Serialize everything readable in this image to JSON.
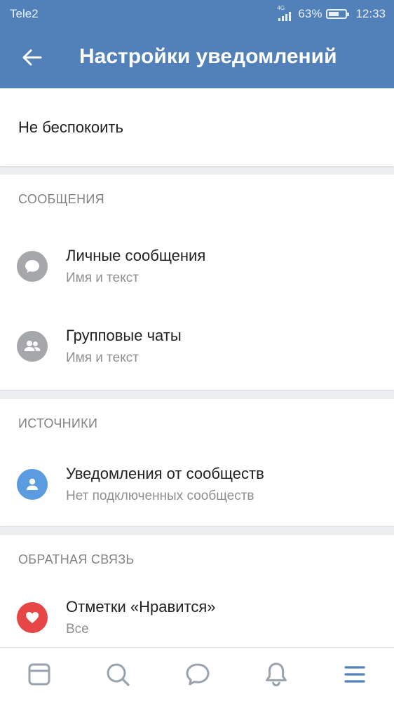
{
  "status_bar": {
    "carrier": "Tele2",
    "network_label": "4G",
    "battery": "63%",
    "battery_level": 0.63,
    "time": "12:33"
  },
  "header": {
    "title": "Настройки уведомлений",
    "back_icon": "arrow-left-icon"
  },
  "do_not_disturb": {
    "label": "Не беспокоить"
  },
  "sections": [
    {
      "title": "СООБЩЕНИЯ",
      "items": [
        {
          "icon": "chat-bubble-icon",
          "title": "Личные сообщения",
          "subtitle": "Имя и текст"
        },
        {
          "icon": "group-icon",
          "title": "Групповые чаты",
          "subtitle": "Имя и текст"
        }
      ]
    },
    {
      "title": "ИСТОЧНИКИ",
      "items": [
        {
          "icon": "user-icon",
          "title": "Уведомления от сообществ",
          "subtitle": "Нет подключенных сообществ"
        }
      ]
    },
    {
      "title": "ОБРАТНАЯ СВЯЗЬ",
      "items": [
        {
          "icon": "heart-icon",
          "title": "Отметки «Нравится»",
          "subtitle": "Все"
        }
      ]
    }
  ],
  "colors": {
    "header": "#5181b8",
    "background": "#ebedf0",
    "gray_icon": "#a5a7ab",
    "blue_icon": "#5b9be0",
    "red_icon": "#e64646",
    "accent": "#5181b8"
  },
  "tabbar": {
    "tabs": [
      {
        "icon": "news-icon"
      },
      {
        "icon": "search-icon"
      },
      {
        "icon": "messages-icon"
      },
      {
        "icon": "bell-icon"
      },
      {
        "icon": "menu-icon",
        "active": true
      }
    ]
  }
}
